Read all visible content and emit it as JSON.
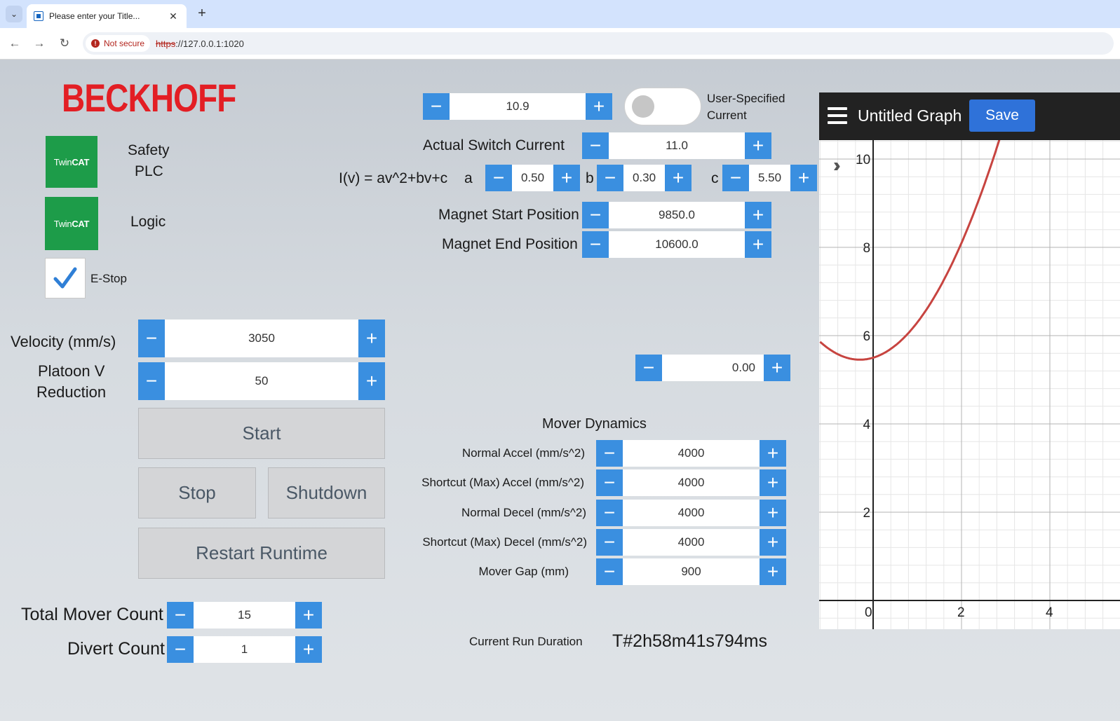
{
  "browser": {
    "tab_title": "Please enter your Title...",
    "tab_close": "✕",
    "new_tab": "+",
    "dropdown": "⌄",
    "back": "←",
    "forward": "→",
    "reload": "↻",
    "security": "Not secure",
    "url_scheme": "https",
    "url_rest": "://127.0.0.1:1020"
  },
  "brand": {
    "logo": "BECKHOFF"
  },
  "twincat_1": {
    "badge_prefix": "Twin",
    "badge_suffix": "CAT",
    "label_line1": "Safety",
    "label_line2": "PLC"
  },
  "twincat_2": {
    "badge_prefix": "Twin",
    "badge_suffix": "CAT",
    "label": "Logic"
  },
  "estop": {
    "label": "E-Stop",
    "checked": true
  },
  "left": {
    "velocity_label": "Velocity (mm/s)",
    "velocity_value": "3050",
    "platoon_label_1": "Platoon V",
    "platoon_label_2": "Reduction",
    "platoon_value": "50",
    "start": "Start",
    "stop": "Stop",
    "shutdown": "Shutdown",
    "restart": "Restart Runtime",
    "total_mover_label": "Total Mover Count",
    "total_mover_value": "15",
    "divert_label": "Divert Count",
    "divert_value": "1"
  },
  "current": {
    "user_specified_value": "10.9",
    "toggle_label_1": "User-Specified",
    "toggle_label_2": "Current",
    "toggle_on": false,
    "actual_label": "Actual Switch Current",
    "actual_value": "11.0",
    "formula": "I(v) = av^2+bv+c",
    "a_label": "a",
    "a_value": "0.50",
    "b_label": "b",
    "b_value": "0.30",
    "c_label": "c",
    "c_value": "5.50",
    "mag_start_label": "Magnet Start Position",
    "mag_start_value": "9850.0",
    "mag_end_label": "Magnet End Position",
    "mag_end_value": "10600.0",
    "misc_value": "0.00"
  },
  "dynamics": {
    "title": "Mover Dynamics",
    "rows": [
      {
        "label": "Normal Accel (mm/s^2)",
        "value": "4000"
      },
      {
        "label": "Shortcut (Max) Accel (mm/s^2)",
        "value": "4000"
      },
      {
        "label": "Normal Decel (mm/s^2)",
        "value": "4000"
      },
      {
        "label": "Shortcut (Max) Decel (mm/s^2)",
        "value": "4000"
      },
      {
        "label": "Mover Gap (mm)",
        "value": "900"
      }
    ]
  },
  "run": {
    "label": "Current Run Duration",
    "value": "T#2h58m41s794ms"
  },
  "stepper": {
    "minus": "−",
    "plus": "+"
  },
  "graph": {
    "title": "Untitled Graph",
    "save": "Save",
    "collapse": "»",
    "curve_color": "#c74440"
  },
  "chart_data": {
    "type": "line",
    "title": "Untitled Graph",
    "xlabel": "",
    "ylabel": "",
    "function": "y = 0.5x^2 + 0.3x + 5.5",
    "xlim": [
      -1.2,
      5.3
    ],
    "ylim": [
      -0.7,
      10.3
    ],
    "x_ticks": [
      0,
      2,
      4
    ],
    "y_ticks": [
      2,
      4,
      6,
      8,
      10
    ],
    "grid": true,
    "series": [
      {
        "x": [
          -1.2,
          -1,
          -0.5,
          -0.3,
          0,
          0.5,
          1,
          1.5,
          2,
          2.5,
          2.9
        ],
        "values": [
          5.86,
          5.7,
          5.48,
          5.455,
          5.5,
          5.775,
          6.3,
          7.075,
          8.1,
          9.375,
          10.54
        ]
      }
    ]
  }
}
